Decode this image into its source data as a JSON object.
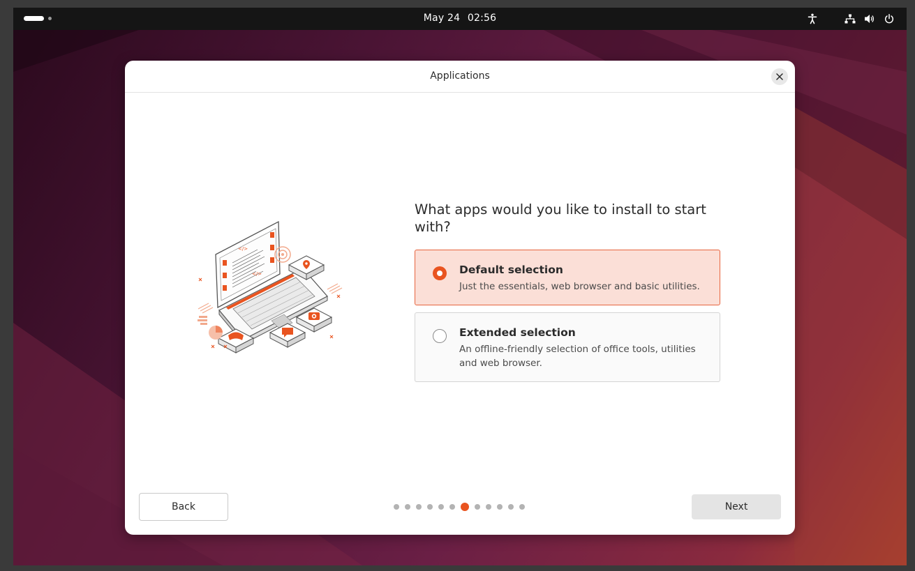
{
  "topbar": {
    "date": "May 24",
    "time": "02:56",
    "icons": [
      "accessibility-icon",
      "network-icon",
      "volume-icon",
      "power-icon"
    ]
  },
  "dialog": {
    "title": "Applications",
    "question": "What apps would you like to install to start with?",
    "options": [
      {
        "title": "Default selection",
        "description": "Just the essentials, web browser and basic utilities.",
        "selected": true
      },
      {
        "title": "Extended selection",
        "description": "An offline-friendly selection of office tools, utilities and web browser.",
        "selected": false
      }
    ],
    "back_label": "Back",
    "next_label": "Next",
    "pager": {
      "total": 12,
      "current": 7
    }
  },
  "colors": {
    "accent": "#e95420",
    "selected_bg": "#fbdfd7",
    "topbar_bg": "#151515"
  }
}
